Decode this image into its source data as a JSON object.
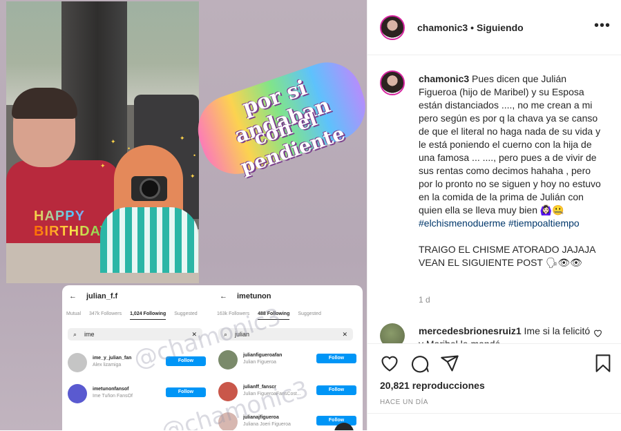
{
  "media": {
    "sticker_line1": "por si andaban",
    "sticker_line2": "con el pendiente",
    "hb_line1": "HAPPY",
    "hb_line2": "BIRTHDAY",
    "watermark": "@chamonic3",
    "left_panel": {
      "profile": "julian_f.f",
      "tabs": [
        "Mutual",
        "347k Followers",
        "1,024 Following",
        "Suggested"
      ],
      "active_tab": "1,024 Following",
      "search_value": "ime",
      "rows": [
        {
          "username": "ime_y_julian_fan",
          "fullname": "Alex lizamiga",
          "button": "Follow"
        },
        {
          "username": "imetunonfansof",
          "fullname": "Ime Tuñon FansOf",
          "button": "Follow"
        }
      ]
    },
    "right_panel": {
      "profile": "imetunon",
      "tabs": [
        "163k Followers",
        "488 Following",
        "Suggested"
      ],
      "active_tab": "488 Following",
      "search_value": "julian",
      "rows": [
        {
          "username": "julianfigueroafan",
          "fullname": "Julian Figueroa",
          "button": "Follow"
        },
        {
          "username": "julianff_fanscr",
          "fullname": "Julian FigueroaFansCost...",
          "button": "Follow"
        },
        {
          "username": "julianajfigueroa",
          "fullname": "Juliana Joeri Figueroa",
          "button": "Follow"
        }
      ]
    }
  },
  "header": {
    "username": "chamonic3",
    "separator": "•",
    "follow_status": "Siguiendo",
    "more": "•••"
  },
  "caption": {
    "username": "chamonic3",
    "body": " Pues dicen que Julián Figueroa (hijo de Maribel) y su Esposa están distanciados ...., no me crean a mi pero según es por q la chava ya se canso de que el literal no haga nada de su vida y le está poniendo el cuerno con la hija de una famosa ... ...., pero pues a de vivir de sus rentas como decimos hahaha , pero por lo pronto no se siguen y hoy no estuvo en la comida de la prima de Julián con quien ella se lleva muy bien 🙆🏻‍♀️🤐",
    "hashtag1": "#elchismenoduerme",
    "hashtag2": "#tiempoaltiempo",
    "body2": "TRAIGO EL CHISME ATORADO JAJAJA VEAN EL SIGUIENTE POST 🗣👁👁",
    "age": "1 d"
  },
  "comment": {
    "username": "mercedesbrionesruiz1",
    "text": " Ime si la felicitó y Maribel le mandó..."
  },
  "actions": {
    "views": "20,821 reproducciones",
    "time": "HACE UN DÍA"
  }
}
